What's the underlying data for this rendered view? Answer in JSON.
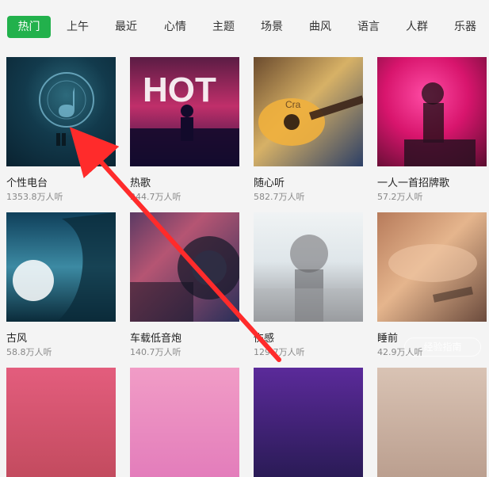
{
  "tabs": [
    {
      "label": "热门",
      "active": true
    },
    {
      "label": "上午",
      "active": false
    },
    {
      "label": "最近",
      "active": false
    },
    {
      "label": "心情",
      "active": false
    },
    {
      "label": "主题",
      "active": false
    },
    {
      "label": "场景",
      "active": false
    },
    {
      "label": "曲风",
      "active": false
    },
    {
      "label": "语言",
      "active": false
    },
    {
      "label": "人群",
      "active": false
    },
    {
      "label": "乐器",
      "active": false
    }
  ],
  "cards": [
    {
      "title": "个性电台",
      "listeners": "1353.8万人听"
    },
    {
      "title": "热歌",
      "listeners": "244.7万人听"
    },
    {
      "title": "随心听",
      "listeners": "582.7万人听"
    },
    {
      "title": "一人一首招牌歌",
      "listeners": "57.2万人听"
    },
    {
      "title": "古风",
      "listeners": "58.8万人听"
    },
    {
      "title": "车载低音炮",
      "listeners": "140.7万人听"
    },
    {
      "title": "伤感",
      "listeners": "129.7万人听"
    },
    {
      "title": "睡前",
      "listeners": "42.9万人听"
    }
  ],
  "covers": {
    "hot_text": "HOT",
    "guitar_text": "Cra"
  },
  "watermark": "经验指南"
}
